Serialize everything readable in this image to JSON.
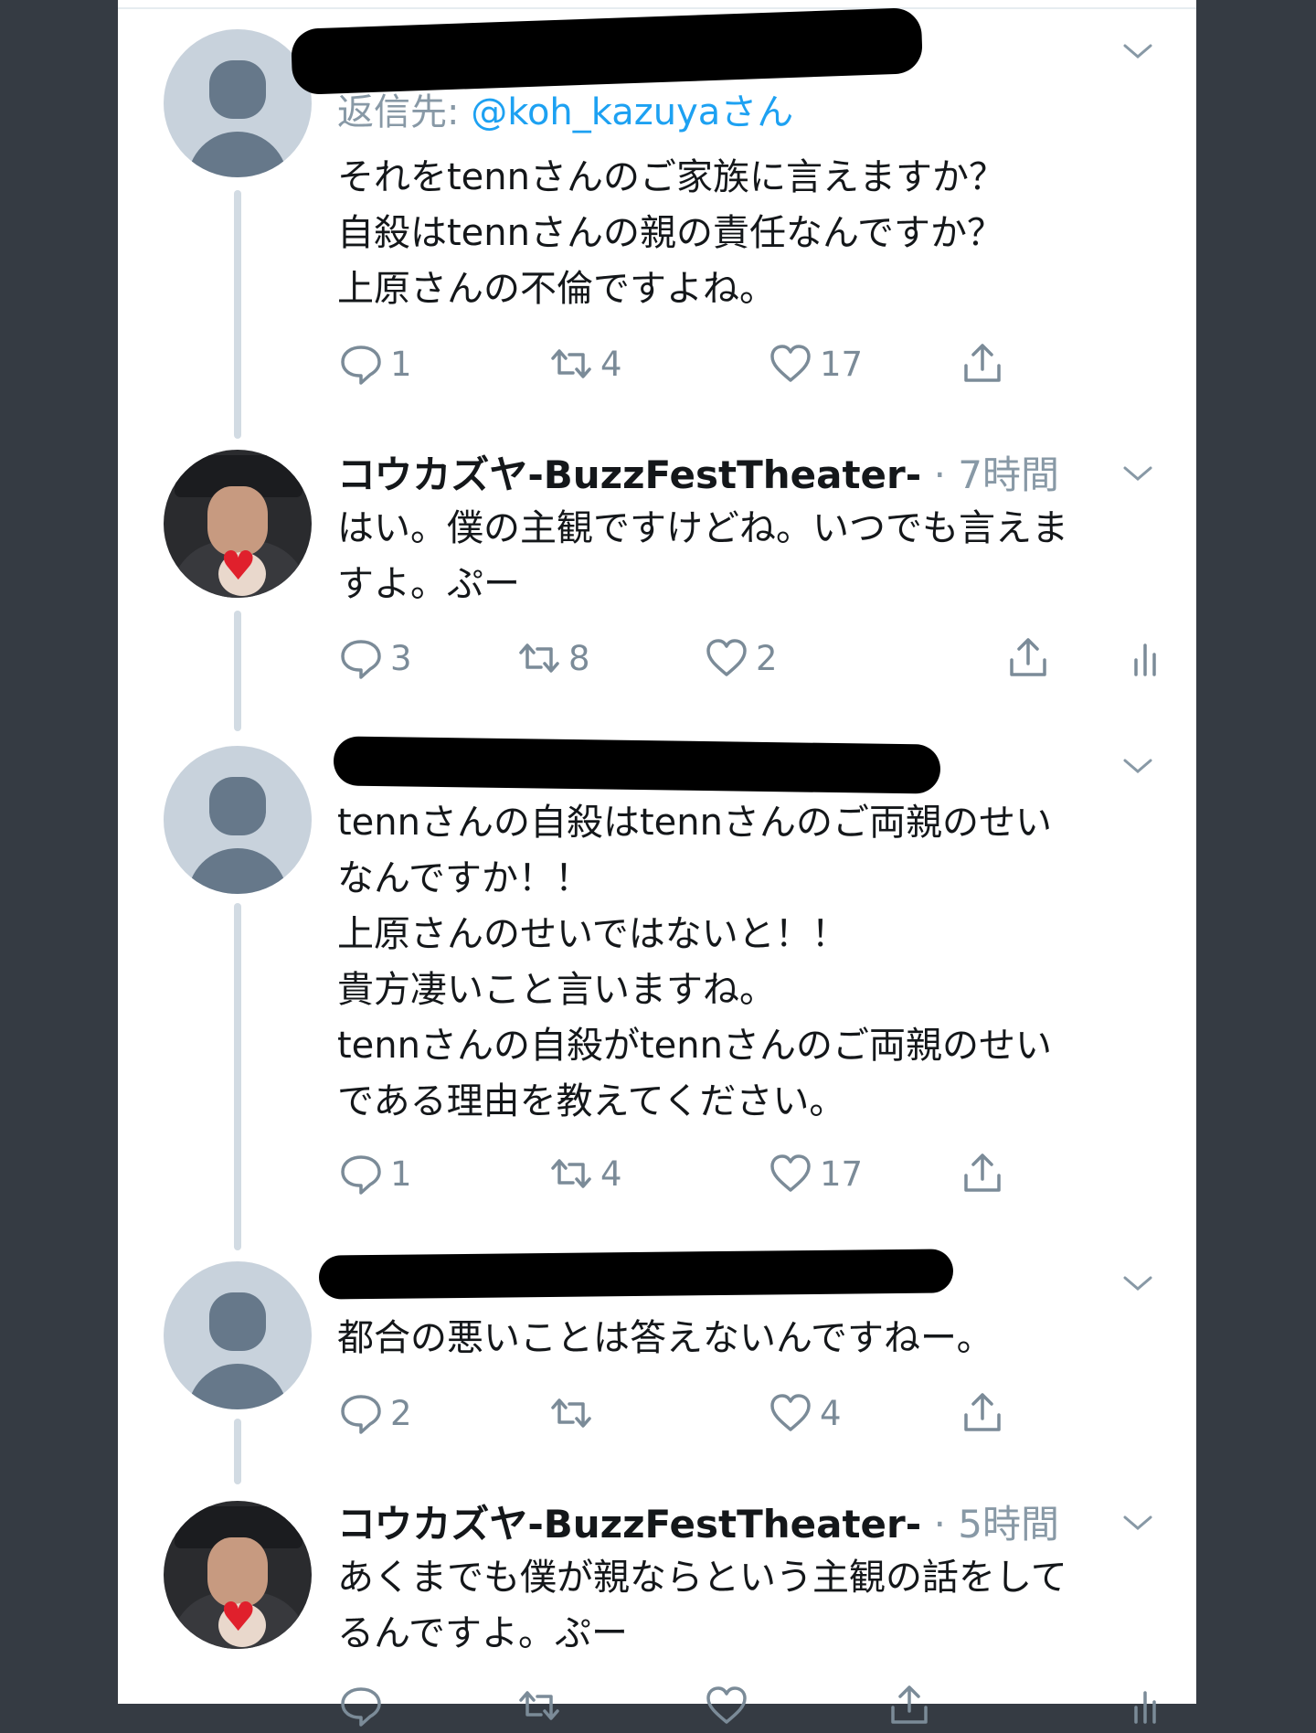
{
  "colors": {
    "accent": "#1da1f2",
    "muted": "#8899a6",
    "text": "#14171a",
    "thread_line": "#d2dbe3"
  },
  "tweets": [
    {
      "replying_label": "返信先:",
      "replying_mention": "@koh_kazuyaさん",
      "text": "それをtennさんのご家族に言えますか？\n自殺はtennさんの親の責任なんですか？\n上原さんの不倫ですよね。",
      "replies": "1",
      "retweets": "4",
      "likes": "17"
    },
    {
      "author": "コウカズヤ-BuzzFestTheater-",
      "time": "· 7時間",
      "text": "はい。僕の主観ですけどね。いつでも言えま\nすよ。ぷー",
      "replies": "3",
      "retweets": "8",
      "likes": "2"
    },
    {
      "text": "tennさんの自殺はtennさんのご両親のせい\nなんですか！！\n上原さんのせいではないと！！\n貴方凄いこと言いますね。\ntennさんの自殺がtennさんのご両親のせい\nである理由を教えてください。",
      "replies": "1",
      "retweets": "4",
      "likes": "17"
    },
    {
      "text": "都合の悪いことは答えないんですねー。",
      "replies": "2",
      "retweets": "",
      "likes": "4"
    },
    {
      "author": "コウカズヤ-BuzzFestTheater-",
      "time": "· 5時間",
      "text": "あくまでも僕が親ならという主観の話をして\nるんですよ。ぷー"
    }
  ],
  "icons": {
    "reply": "speech-bubble-icon",
    "retweet": "retweet-arrows-icon",
    "like": "heart-outline-icon",
    "share": "share-upload-icon",
    "analytics": "bar-chart-icon",
    "more": "chevron-down-icon"
  }
}
